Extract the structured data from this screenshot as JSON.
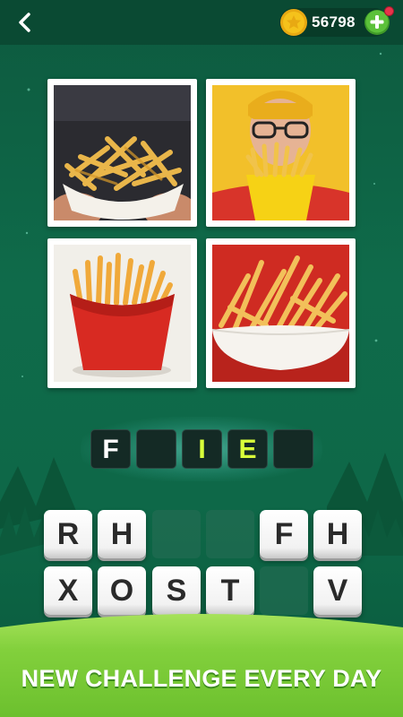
{
  "header": {
    "back_icon": "chevron-left-icon",
    "coins": "56798",
    "coin_icon": "gold-coin-icon",
    "add_icon": "plus-icon",
    "has_notification": true
  },
  "photos": [
    {
      "name": "fries-in-hands"
    },
    {
      "name": "man-with-fries"
    },
    {
      "name": "fries-red-box"
    },
    {
      "name": "fries-white-bowl"
    }
  ],
  "answer": {
    "slots": [
      "F",
      "",
      "I",
      "E",
      ""
    ],
    "revealed_color": "#ffffff",
    "hint_color": "#d9ff3a"
  },
  "keyboard": {
    "row1": [
      "R",
      "H",
      "",
      "",
      "F",
      "H"
    ],
    "row2": [
      "X",
      "O",
      "S",
      "T",
      "",
      "V"
    ]
  },
  "banner": {
    "text": "NEW CHALLENGE EVERY DAY"
  },
  "colors": {
    "background": "#0f6b4a",
    "banner_green": "#7fd13a",
    "coin_gold": "#f5c21b",
    "plus_green": "#5cc13a"
  }
}
